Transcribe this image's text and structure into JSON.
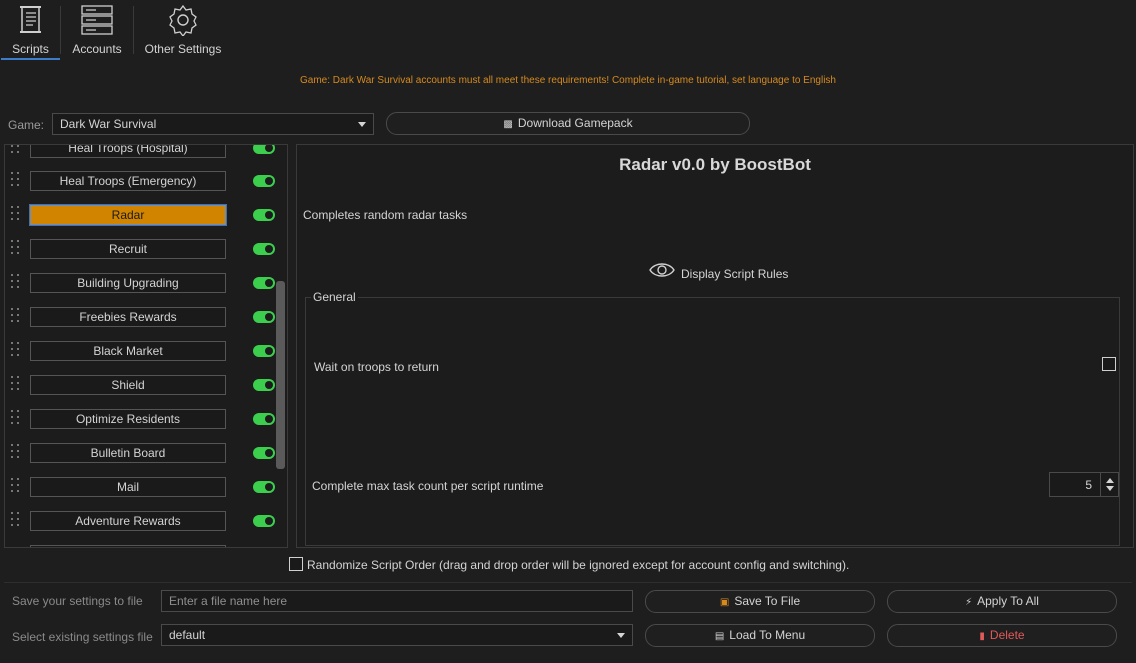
{
  "tabs": [
    {
      "label": "Scripts",
      "icon": "scroll-icon",
      "active": true
    },
    {
      "label": "Accounts",
      "icon": "server-icon",
      "active": false
    },
    {
      "label": "Other Settings",
      "icon": "gear-icon",
      "active": false
    }
  ],
  "notice": "Game: Dark War Survival accounts must all meet these requirements! Complete in-game tutorial, set language to English",
  "game": {
    "label": "Game:",
    "selected": "Dark War Survival",
    "download_label": "Download Gamepack"
  },
  "scripts": [
    {
      "label": "Heal Troops (Hospital)",
      "enabled": true,
      "active": false
    },
    {
      "label": "Heal Troops (Emergency)",
      "enabled": true,
      "active": false
    },
    {
      "label": "Radar",
      "enabled": true,
      "active": true
    },
    {
      "label": "Recruit",
      "enabled": true,
      "active": false
    },
    {
      "label": "Building Upgrading",
      "enabled": true,
      "active": false
    },
    {
      "label": "Freebies Rewards",
      "enabled": true,
      "active": false
    },
    {
      "label": "Black Market",
      "enabled": true,
      "active": false
    },
    {
      "label": "Shield",
      "enabled": true,
      "active": false
    },
    {
      "label": "Optimize Residents",
      "enabled": true,
      "active": false
    },
    {
      "label": "Bulletin Board",
      "enabled": true,
      "active": false
    },
    {
      "label": "Mail",
      "enabled": true,
      "active": false
    },
    {
      "label": "Adventure Rewards",
      "enabled": true,
      "active": false
    }
  ],
  "detail": {
    "title": "Radar v0.0 by BoostBot",
    "description": "Completes random radar tasks",
    "rules_label": "Display Script Rules",
    "group_title": "General",
    "option_wait": "Wait on troops to return",
    "option_wait_checked": false,
    "option_max": "Complete max task count per script runtime",
    "option_max_value": "5"
  },
  "randomize": {
    "label": "Randomize Script Order (drag and drop order will be ignored except for account config and switching).",
    "checked": false
  },
  "settings": {
    "save_label": "Save your settings to file",
    "file_placeholder": "Enter a file name here",
    "save_button": "Save To File",
    "apply_button": "Apply To All",
    "select_label": "Select existing settings file",
    "selected_file": "default",
    "load_button": "Load To Menu",
    "delete_button": "Delete"
  },
  "colors": {
    "accent": "#d08400",
    "toggle_on": "#3ccf4e",
    "notice": "#d68a1e",
    "danger": "#e05a5a"
  }
}
